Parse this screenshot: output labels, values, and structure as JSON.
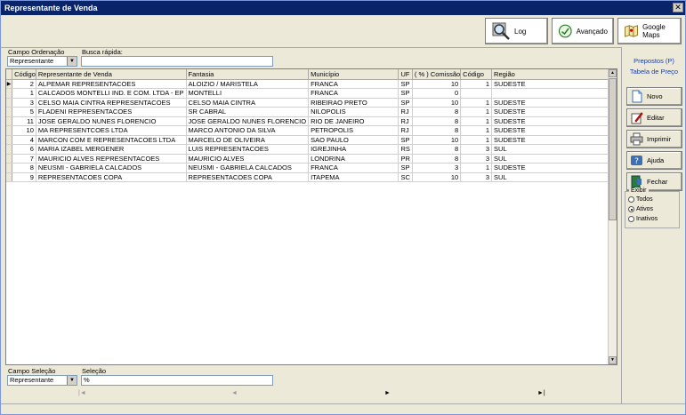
{
  "window": {
    "title": "Representante de Venda",
    "close_glyph": "✕"
  },
  "toolbar": {
    "log_label": "Log",
    "advanced_label": "Avançado",
    "maps_label": "Google Maps"
  },
  "search": {
    "order_label": "Campo Ordenação",
    "order_value": "Representante",
    "quick_label": "Busca rápida:",
    "quick_value": ""
  },
  "grid": {
    "columns": [
      "Código",
      "Representante de Venda",
      "Fantasia",
      "Município",
      "UF",
      "( % ) Comissão",
      "Código",
      "Região"
    ],
    "rows": [
      [
        "2",
        "ALPEMAR REPRESENTACOES",
        "ALOIZIO / MARISTELA",
        "FRANCA",
        "SP",
        "10",
        "1",
        "SUDESTE"
      ],
      [
        "1",
        "CALCADOS MONTELLI IND. E COM. LTDA - EP",
        "MONTELLI",
        "FRANCA",
        "SP",
        "0",
        "",
        ""
      ],
      [
        "3",
        "CELSO MAIA CINTRA REPRESENTACOES",
        "CELSO MAIA CINTRA",
        "RIBEIRAO PRETO",
        "SP",
        "10",
        "1",
        "SUDESTE"
      ],
      [
        "5",
        "FLADENI REPRESENTACOES",
        "SR CABRAL",
        "NILOPOLIS",
        "RJ",
        "8",
        "1",
        "SUDESTE"
      ],
      [
        "11",
        "JOSE GERALDO NUNES FLORENCIO",
        "JOSE GERALDO NUNES FLORENCIO",
        "RIO DE JANEIRO",
        "RJ",
        "8",
        "1",
        "SUDESTE"
      ],
      [
        "10",
        "MA REPRESENTCOES LTDA",
        "MARCO ANTONIO DA SILVA",
        "PETROPOLIS",
        "RJ",
        "8",
        "1",
        "SUDESTE"
      ],
      [
        "4",
        "MARCON COM E REPRESENTACOES LTDA",
        "MARCELO DE OLIVEIRA",
        "SAO PAULO",
        "SP",
        "10",
        "1",
        "SUDESTE"
      ],
      [
        "6",
        "MARIA IZABEL MERGENER",
        "LUIS REPRESENTACOES",
        "IGREJINHA",
        "RS",
        "8",
        "3",
        "SUL"
      ],
      [
        "7",
        "MAURICIO ALVES REPRESENTACOES",
        "MAURICIO ALVES",
        "LONDRINA",
        "PR",
        "8",
        "3",
        "SUL"
      ],
      [
        "8",
        "NEUSMI - GABRIELA CALCADOS",
        "NEUSMI - GABRIELA CALCADOS",
        "FRANCA",
        "SP",
        "3",
        "1",
        "SUDESTE"
      ],
      [
        "9",
        "REPRESENTACOES COPA",
        "REPRESENTACOES COPA",
        "ITAPEMA",
        "SC",
        "10",
        "3",
        "SUL"
      ]
    ]
  },
  "side": {
    "link1": "Prepostos (P)",
    "link2": "Tabela de Preço",
    "new_label": "Novo",
    "edit_label": "Editar",
    "print_label": "Imprimir",
    "help_label": "Ajuda",
    "close_label": "Fechar",
    "show_caption": "Exibir",
    "opt_all": "Todos",
    "opt_active": "Ativos",
    "opt_inactive": "Inativos"
  },
  "selection": {
    "field_label": "Campo Seleção",
    "field_value": "Representante",
    "sel_label": "Seleção",
    "sel_value": "%"
  },
  "nav": {
    "first": "|◄",
    "prev": "◄",
    "next": "►",
    "last": "►|"
  }
}
